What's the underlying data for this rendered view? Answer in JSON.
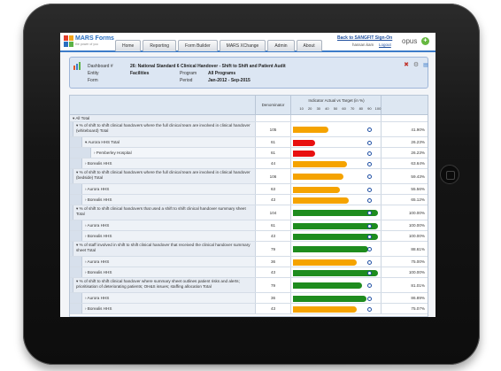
{
  "app": {
    "brand": "MARS Forms",
    "tagline": "the power of you",
    "tabs": [
      "Home",
      "Reporting",
      "Form Builder",
      "MARS XChange",
      "Admin",
      "About"
    ],
    "back_link": "Back to SANGFIT Sign-On",
    "user": "hassan.kam",
    "logout": "Logout",
    "vendor": "opus"
  },
  "info": {
    "dashboard_label": "Dashboard #",
    "dashboard_value": "26: National Standard 6 Clinical Handover - Shift to Shift and Patient Audit",
    "entity_label": "Entity",
    "entity_value": "Facilities",
    "program_label": "Program",
    "program_value": "All Programs",
    "form_label": "Form",
    "period_label": "Period",
    "period_value": "Jan-2012 - Sep-2015"
  },
  "table": {
    "col_denominator": "Denominator",
    "col_indicator": "Indicator Actual vs Target (in %)",
    "axis_ticks": [
      "10",
      "20",
      "30",
      "40",
      "50",
      "60",
      "70",
      "80",
      "90",
      "100"
    ],
    "rows": [
      {
        "label": "▾ All Total",
        "level": 0,
        "denom": "",
        "pct": "",
        "actual": null,
        "target": null,
        "color": null
      },
      {
        "label": "▾ % of shift to shift clinical handovers where the full clinical team are involved in clinical handover (whiteboard) Total",
        "level": 1,
        "denom": "105",
        "pct": "41.90%",
        "actual": 41.9,
        "target": 90,
        "color": "#f5a300"
      },
      {
        "label": "▾ Aurora HHS Total",
        "level": 2,
        "denom": "61",
        "pct": "26.23%",
        "actual": 26.23,
        "target": 90,
        "color": "#e81010"
      },
      {
        "label": "› Pemberley Hospital",
        "level": 3,
        "denom": "61",
        "pct": "26.23%",
        "actual": 26.23,
        "target": 90,
        "color": "#e81010"
      },
      {
        "label": "› Borealis HHS",
        "level": 2,
        "denom": "44",
        "pct": "63.64%",
        "actual": 63.64,
        "target": 90,
        "color": "#f5a300"
      },
      {
        "label": "▾ % of shift to shift clinical handovers where the full clinical team are involved in clinical handover (bedside) Total",
        "level": 1,
        "denom": "106",
        "pct": "59.43%",
        "actual": 59.43,
        "target": 90,
        "color": "#f5a300"
      },
      {
        "label": "› Aurora HHS",
        "level": 2,
        "denom": "63",
        "pct": "55.56%",
        "actual": 55.56,
        "target": 90,
        "color": "#f5a300"
      },
      {
        "label": "› Borealis HHS",
        "level": 2,
        "denom": "43",
        "pct": "65.12%",
        "actual": 65.12,
        "target": 90,
        "color": "#f5a300"
      },
      {
        "label": "▾ % of shift to shift clinical handovers that used a shift to shift clinical handover summary sheet Total",
        "level": 1,
        "denom": "104",
        "pct": "100.00%",
        "actual": 100,
        "target": 90,
        "color": "#1e8c1e"
      },
      {
        "label": "› Aurora HHS",
        "level": 2,
        "denom": "61",
        "pct": "100.00%",
        "actual": 100,
        "target": 90,
        "color": "#1e8c1e"
      },
      {
        "label": "› Borealis HHS",
        "level": 2,
        "denom": "43",
        "pct": "100.00%",
        "actual": 100,
        "target": 90,
        "color": "#1e8c1e"
      },
      {
        "label": "▾ % of staff involved in shift to shift clinical handover that received the clinical handover summary sheet Total",
        "level": 1,
        "denom": "79",
        "pct": "88.61%",
        "actual": 88.61,
        "target": 90,
        "color": "#1e8c1e"
      },
      {
        "label": "› Aurora HHS",
        "level": 2,
        "denom": "36",
        "pct": "75.00%",
        "actual": 75,
        "target": 90,
        "color": "#f5a300"
      },
      {
        "label": "› Borealis HHS",
        "level": 2,
        "denom": "43",
        "pct": "100.00%",
        "actual": 100,
        "target": 90,
        "color": "#1e8c1e"
      },
      {
        "label": "▾ % of shift to shift clinical handover where summary sheet outlines patient risks and alerts; prioritisation of deteriorating patients; OH&S issues; staffing allocation Total",
        "level": 1,
        "denom": "79",
        "pct": "81.01%",
        "actual": 81.01,
        "target": 90,
        "color": "#1e8c1e"
      },
      {
        "label": "› Aurora HHS",
        "level": 2,
        "denom": "36",
        "pct": "86.89%",
        "actual": 86.89,
        "target": 90,
        "color": "#1e8c1e"
      },
      {
        "label": "› Borealis HHS",
        "level": 2,
        "denom": "43",
        "pct": "75.07%",
        "actual": 75.07,
        "target": 90,
        "color": "#f5a300"
      }
    ]
  }
}
